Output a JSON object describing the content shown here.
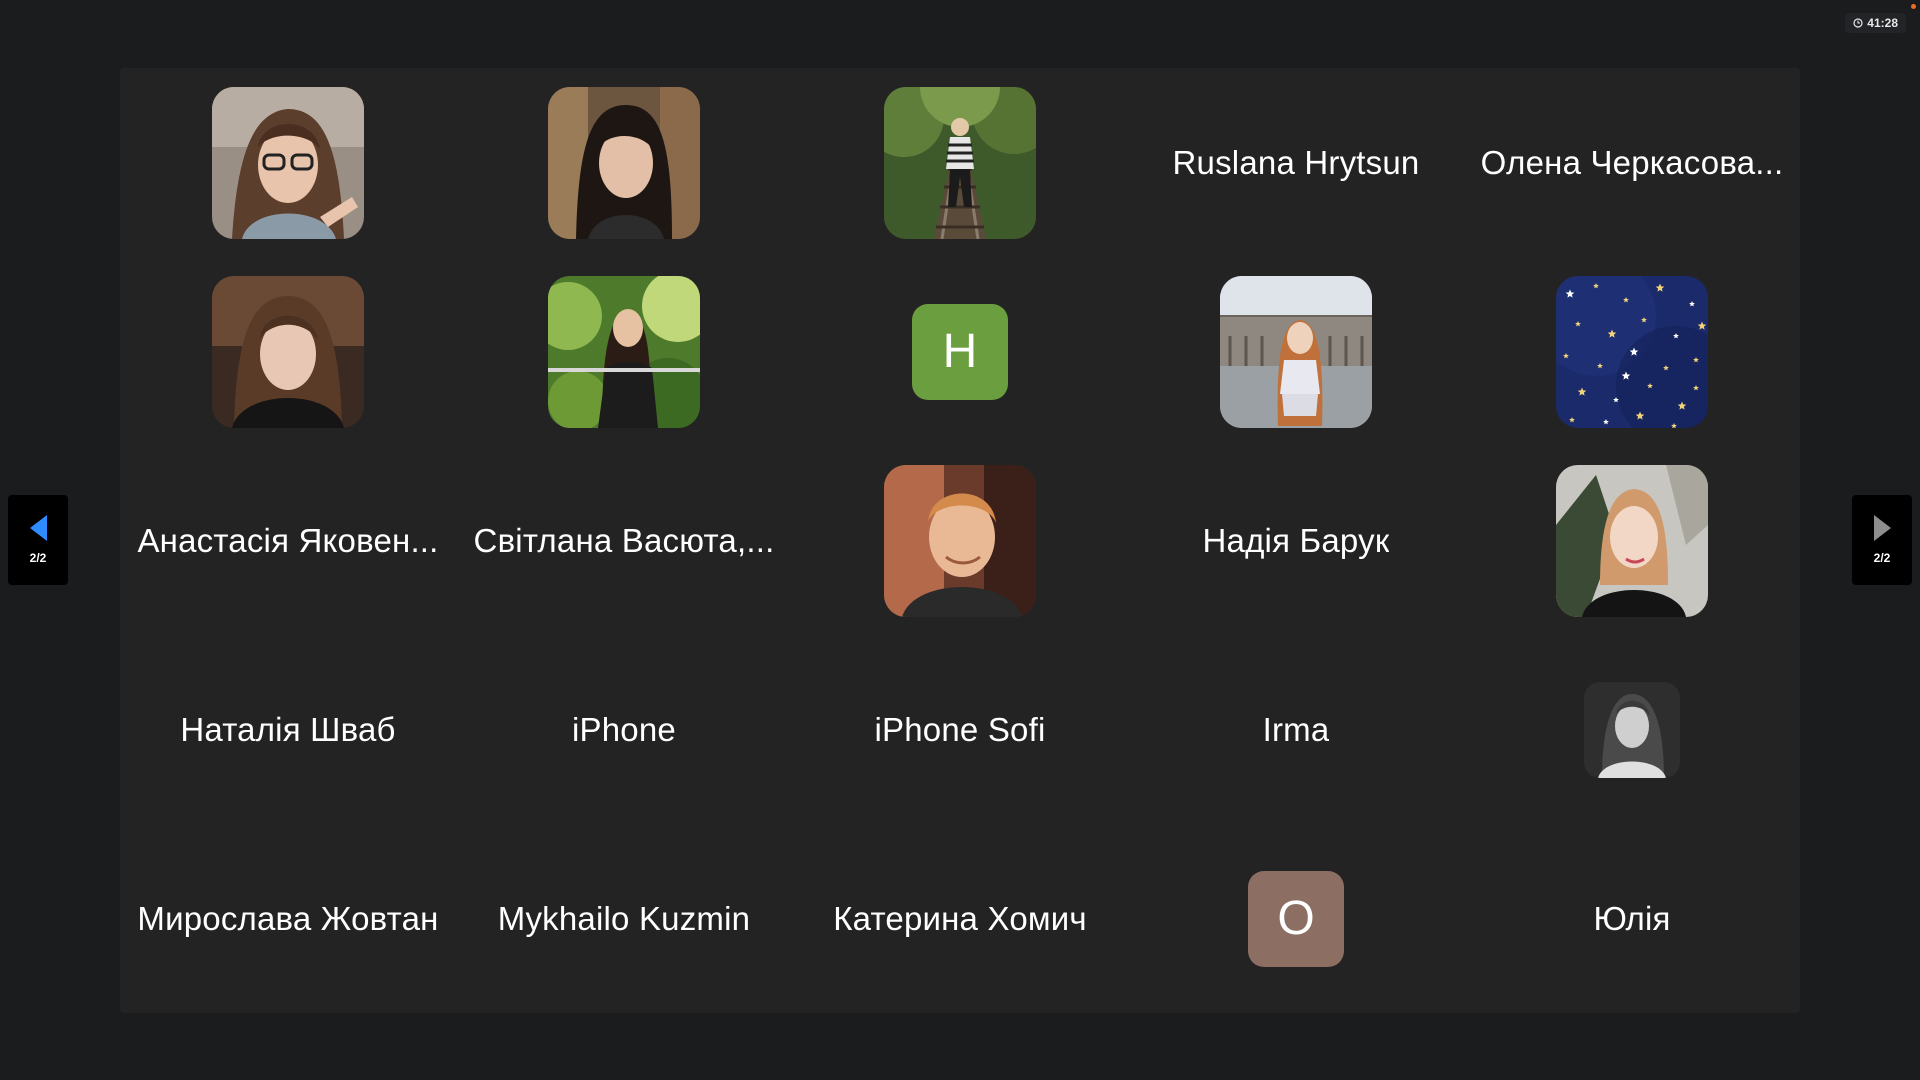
{
  "meeting": {
    "elapsed_time": "41:28",
    "page_indicator": "2/2"
  },
  "participants": [
    {
      "display": "photo",
      "photo": "woman-glasses"
    },
    {
      "display": "photo",
      "photo": "woman-dark-hair"
    },
    {
      "display": "photo",
      "photo": "woman-railway"
    },
    {
      "display": "name",
      "name": "Ruslana Hrytsun"
    },
    {
      "display": "name",
      "name": "Олена Черкасова..."
    },
    {
      "display": "photo",
      "photo": "woman-black-hoodie"
    },
    {
      "display": "photo",
      "photo": "woman-garden"
    },
    {
      "display": "initial",
      "initial": "H",
      "color": "#6a9e3f"
    },
    {
      "display": "photo",
      "photo": "woman-square"
    },
    {
      "display": "photo",
      "photo": "starry-sky"
    },
    {
      "display": "name",
      "name": "Анастасія Яковен..."
    },
    {
      "display": "name",
      "name": "Світлана Васюта,..."
    },
    {
      "display": "photo",
      "photo": "man-portrait"
    },
    {
      "display": "name",
      "name": "Надія Барук"
    },
    {
      "display": "photo",
      "photo": "woman-redhead"
    },
    {
      "display": "name",
      "name": "Наталія Шваб"
    },
    {
      "display": "name",
      "name": "iPhone"
    },
    {
      "display": "name",
      "name": "iPhone Sofi"
    },
    {
      "display": "name",
      "name": "Irma"
    },
    {
      "display": "photo-small",
      "photo": "woman-bw"
    },
    {
      "display": "name",
      "name": "Мирослава Жовтан"
    },
    {
      "display": "name",
      "name": "Mykhailo Kuzmin"
    },
    {
      "display": "name",
      "name": "Катерина Хомич"
    },
    {
      "display": "initial",
      "initial": "O",
      "color": "#8c6e63"
    },
    {
      "display": "name",
      "name": "Юлія"
    }
  ],
  "colors": {
    "background": "#1b1c1e",
    "tile_background": "#232323",
    "nav_active_arrow": "#2d8cff",
    "nav_inactive_arrow": "#8e8e8e",
    "recording_dot": "#f26b21"
  }
}
